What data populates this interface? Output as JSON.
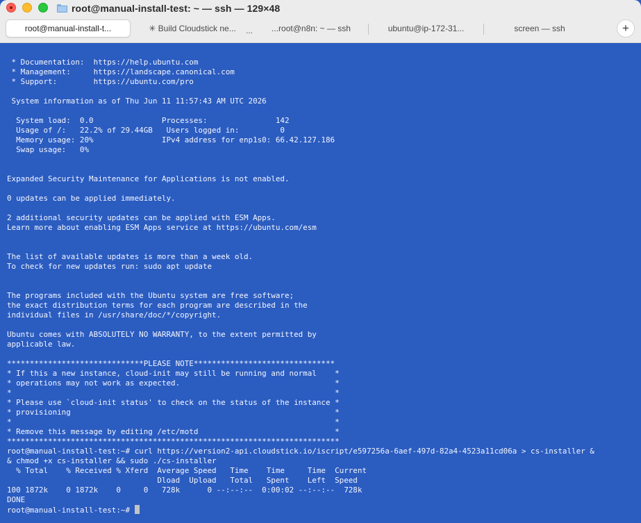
{
  "window": {
    "title": "root@manual-install-test: ~ — ssh — 129×48"
  },
  "tabs": [
    {
      "label": "root@manual-install-t...",
      "active": true
    },
    {
      "label": "✳ Build Cloudstick ne...",
      "active": false,
      "extra": "..."
    },
    {
      "label": "...root@n8n: ~ — ssh",
      "active": false
    },
    {
      "label": "ubuntu@ip-172-31...",
      "active": false
    },
    {
      "label": "screen — ssh",
      "active": false
    }
  ],
  "add_tab_label": "+",
  "terminal": {
    "lines": [
      " * Documentation:  https://help.ubuntu.com",
      " * Management:     https://landscape.canonical.com",
      " * Support:        https://ubuntu.com/pro",
      "",
      " System information as of Thu Jun 11 11:57:43 AM UTC 2026",
      "",
      "  System load:  0.0               Processes:               142",
      "  Usage of /:   22.2% of 29.44GB   Users logged in:         0",
      "  Memory usage: 20%               IPv4 address for enp1s0: 66.42.127.186",
      "  Swap usage:   0%",
      "",
      "",
      "Expanded Security Maintenance for Applications is not enabled.",
      "",
      "0 updates can be applied immediately.",
      "",
      "2 additional security updates can be applied with ESM Apps.",
      "Learn more about enabling ESM Apps service at https://ubuntu.com/esm",
      "",
      "",
      "The list of available updates is more than a week old.",
      "To check for new updates run: sudo apt update",
      "",
      "",
      "The programs included with the Ubuntu system are free software;",
      "the exact distribution terms for each program are described in the",
      "individual files in /usr/share/doc/*/copyright.",
      "",
      "Ubuntu comes with ABSOLUTELY NO WARRANTY, to the extent permitted by",
      "applicable law.",
      "",
      "******************************PLEASE NOTE*******************************",
      "* If this a new instance, cloud-init may still be running and normal    *",
      "* operations may not work as expected.                                  *",
      "*                                                                       *",
      "* Please use `cloud-init status' to check on the status of the instance *",
      "* provisioning                                                          *",
      "*                                                                       *",
      "* Remove this message by editing /etc/motd                              *",
      "*************************************************************************",
      "root@manual-install-test:~# curl https://version2-api.cloudstick.io/iscript/e597256a-6aef-497d-82a4-4523a11cd06a > cs-installer &",
      "& chmod +x cs-installer && sudo ./cs-installer",
      "  % Total    % Received % Xferd  Average Speed   Time    Time     Time  Current",
      "                                 Dload  Upload   Total   Spent    Left  Speed",
      "100 1872k    0 1872k    0     0   728k      0 --:--:--  0:00:02 --:--:--  728k",
      "DONE"
    ],
    "prompt": "root@manual-install-test:~# "
  }
}
